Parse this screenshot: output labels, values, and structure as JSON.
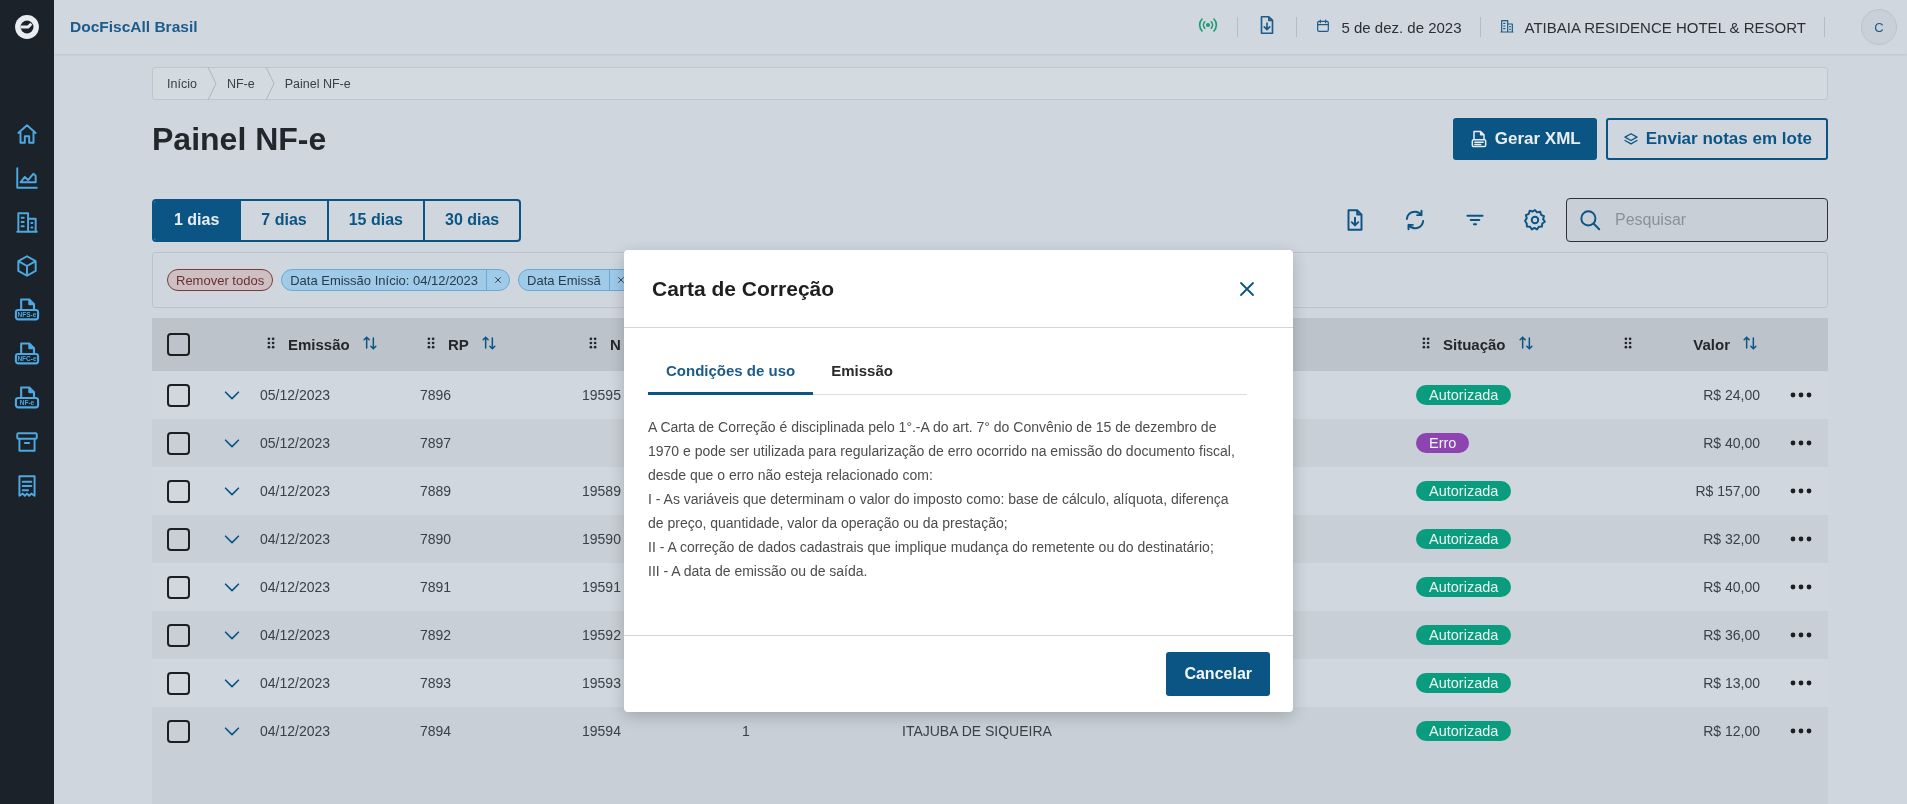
{
  "app": {
    "title": "DocFiscAll Brasil",
    "date": "5 de dez. de 2023",
    "company": "ATIBAIA RESIDENCE HOTEL & RESORT",
    "avatar": "C"
  },
  "sidebar": {
    "items": [
      {
        "kind": "home"
      },
      {
        "kind": "chart"
      },
      {
        "kind": "building"
      },
      {
        "kind": "box"
      },
      {
        "kind": "doc",
        "badge": "NFS-e"
      },
      {
        "kind": "doc",
        "badge": "NFC-e"
      },
      {
        "kind": "doc",
        "badge": "NF-e"
      },
      {
        "kind": "archive"
      },
      {
        "kind": "receipt"
      }
    ]
  },
  "breadcrumb": [
    "Início",
    "NF-e",
    "Painel NF-e"
  ],
  "page_title": "Painel NF-e",
  "actions": [
    {
      "label": "Gerar XML",
      "kind": "primary"
    },
    {
      "label": "Enviar notas em lote",
      "kind": "secondary"
    }
  ],
  "period_tabs": [
    {
      "label": "1 dias",
      "selected": true
    },
    {
      "label": "7 dias",
      "selected": false
    },
    {
      "label": "15 dias",
      "selected": false
    },
    {
      "label": "30 dias",
      "selected": false
    }
  ],
  "search": {
    "placeholder": "Pesquisar"
  },
  "filters": [
    {
      "label": "Remover todos",
      "kind": "clear"
    },
    {
      "label": "Data Emissão Início: 04/12/2023",
      "kind": "filter"
    },
    {
      "label": "Data Emissã",
      "kind": "filter"
    }
  ],
  "table": {
    "select_all": {
      "checked": false
    },
    "columns": [
      {
        "label": "Emissão",
        "sortable": true
      },
      {
        "label": "RP",
        "sortable": true
      },
      {
        "label": "N"
      },
      {
        "label": "Situação",
        "sortable": true
      },
      {},
      {
        "label": "Valor",
        "sortable": true
      }
    ],
    "rows": [
      {
        "checked": false,
        "expanded": false,
        "emissao": "05/12/2023",
        "rp": "7896",
        "numero": "19595",
        "situacao": {
          "label": "Autorizada",
          "color": "#0a9c7e"
        },
        "valor": "R$ 24,00"
      },
      {
        "checked": false,
        "expanded": false,
        "emissao": "05/12/2023",
        "rp": "7897",
        "situacao": {
          "label": "Erro",
          "color": "#8d44b0"
        },
        "valor": "R$ 40,00"
      },
      {
        "checked": false,
        "expanded": false,
        "emissao": "04/12/2023",
        "rp": "7889",
        "numero": "19589",
        "situacao": {
          "label": "Autorizada",
          "color": "#0a9c7e"
        },
        "valor": "R$ 157,00"
      },
      {
        "checked": false,
        "expanded": false,
        "emissao": "04/12/2023",
        "rp": "7890",
        "numero": "19590",
        "situacao": {
          "label": "Autorizada",
          "color": "#0a9c7e"
        },
        "valor": "R$ 32,00"
      },
      {
        "checked": false,
        "expanded": false,
        "emissao": "04/12/2023",
        "rp": "7891",
        "numero": "19591",
        "situacao": {
          "label": "Autorizada",
          "color": "#0a9c7e"
        },
        "valor": "R$ 40,00"
      },
      {
        "checked": false,
        "expanded": false,
        "emissao": "04/12/2023",
        "rp": "7892",
        "numero": "19592",
        "situacao": {
          "label": "Autorizada",
          "color": "#0a9c7e"
        },
        "valor": "R$ 36,00"
      },
      {
        "checked": false,
        "expanded": false,
        "emissao": "04/12/2023",
        "rp": "7893",
        "numero": "19593",
        "situacao": {
          "label": "Autorizada",
          "color": "#0a9c7e"
        },
        "valor": "R$ 13,00"
      },
      {
        "checked": false,
        "expanded": false,
        "emissao": "04/12/2023",
        "rp": "7894",
        "numero": "19594",
        "column_4": "1",
        "column_5": "ITAJUBA DE SIQUEIRA",
        "situacao": {
          "label": "Autorizada",
          "color": "#0a9c7e"
        },
        "valor": "R$ 12,00"
      }
    ]
  },
  "dialog": {
    "title": "Carta de Correção",
    "tabs": [
      {
        "label": "Condições de uso",
        "selected": true
      },
      {
        "label": "Emissão",
        "selected": false
      }
    ],
    "paragraphs": [
      "A Carta de Correção é disciplinada pelo 1°.-A do art. 7° do Convênio de 15 de dezembro de 1970 e pode ser utilizada para regularização de erro ocorrido na emissão do documento fiscal, desde que o erro não esteja relacionado com:",
      "I - As variáveis que determinam o valor do imposto como: base de cálculo, alíquota, diferença de preço, quantidade, valor da operação ou da prestação;",
      "II - A correção de dados cadastrais que implique mudança do remetente ou do destinatário;",
      "III - A data de emissão ou de saída."
    ],
    "buttons": [
      {
        "label": "Cancelar",
        "kind": "primary"
      }
    ]
  }
}
